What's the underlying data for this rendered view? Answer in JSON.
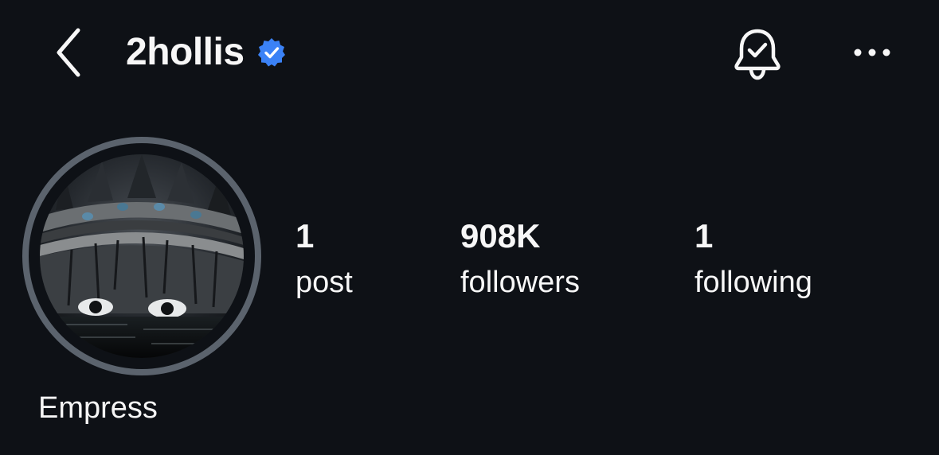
{
  "header": {
    "username": "2hollis",
    "verified": true,
    "back_icon": "chevron-left-icon",
    "notification_icon": "bell-check-icon",
    "more_icon": "ellipsis-horizontal-icon"
  },
  "profile": {
    "display_name": "Empress",
    "avatar_description_icon": "avatar-image",
    "stats": [
      {
        "value": "1",
        "label": "post"
      },
      {
        "value": "908K",
        "label": "followers"
      },
      {
        "value": "1",
        "label": "following"
      }
    ]
  },
  "colors": {
    "background": "#0e1116",
    "text": "#f7f7f7",
    "verified_badge": "#3b82f6",
    "avatar_ring": "#5b636d"
  }
}
